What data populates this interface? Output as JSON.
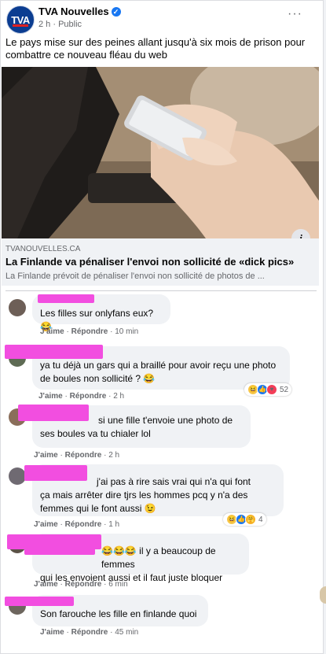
{
  "post": {
    "page_name": "TVA Nouvelles",
    "avatar_logo": "TVA",
    "time": "2 h",
    "audience": "Public",
    "text": "Le pays mise sur des peines allant jusqu'à six mois de prison pour combattre ce nouveau fléau du web",
    "more_icon": "···",
    "info_icon": "i"
  },
  "link": {
    "domain": "TVANOUVELLES.CA",
    "title": "La Finlande va pénaliser l'envoi non sollicité de «dick pics»",
    "description": "La Finlande prévoit de pénaliser l'envoi non sollicité de photos de ..."
  },
  "comments": [
    {
      "lines": [
        "Les filles sur onlyfans eux?😂"
      ],
      "like": "J'aime",
      "reply": "Répondre",
      "time": "10 min"
    },
    {
      "lines": [
        "ya tu déjà un gars qui a braillé pour avoir reçu une photo",
        "de boules non sollicité ? 😂"
      ],
      "like": "J'aime",
      "reply": "Répondre",
      "time": "2 h",
      "reaction_count": "52"
    },
    {
      "lines": [
        "si une fille t'envoie une photo de",
        "ses boules va tu chialer lol"
      ],
      "like": "J'aime",
      "reply": "Répondre",
      "time": "2 h"
    },
    {
      "lines": [
        "j'ai pas à rire sais vrai qui n'a qui font",
        "ça mais arrêter dire tjrs les hommes pcq y n'a des",
        "femmes qui le font aussi 😉"
      ],
      "like": "J'aime",
      "reply": "Répondre",
      "time": "1 h",
      "reaction_count": "4"
    },
    {
      "lines": [
        "😂😂😂 il y a beaucoup de femmes",
        "qui les envoient aussi et il faut juste bloquer"
      ],
      "like": "J'aime",
      "reply": "Répondre",
      "time": "6 min"
    },
    {
      "lines": [
        "Son farouche les fille en finlande quoi"
      ],
      "like": "J'aime",
      "reply": "Répondre",
      "time": "45 min"
    }
  ]
}
